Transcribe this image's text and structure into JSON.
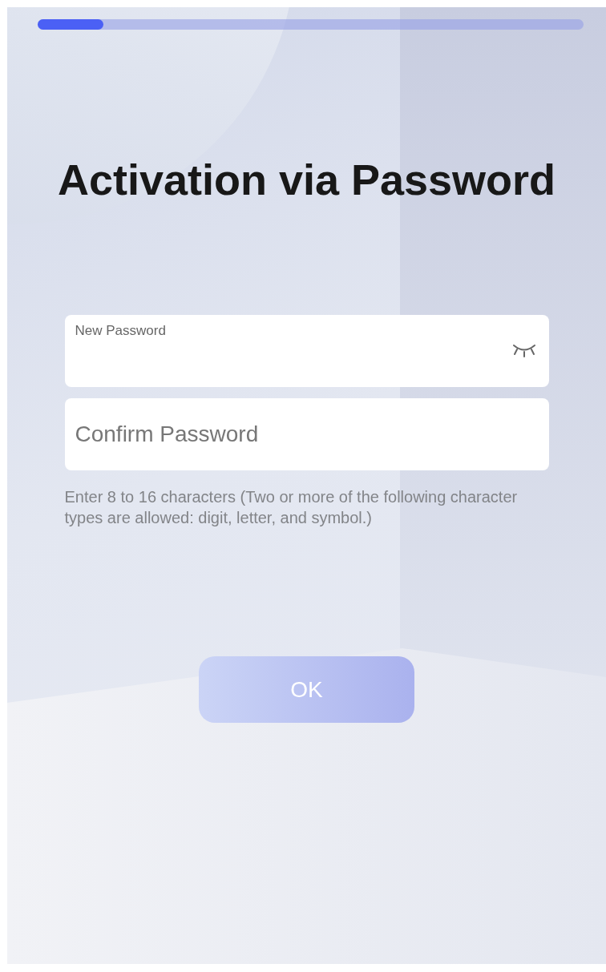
{
  "progress": {
    "level": 0.12
  },
  "title": "Activation via Password",
  "fields": [
    {
      "kind": "floating",
      "label": "New Password",
      "password_visible": false
    },
    {
      "kind": "plain",
      "placeholder": "Confirm Password"
    }
  ],
  "hint": "Enter 8 to 16 characters (Two or more of the following character types are allowed: digit, letter, and symbol.)",
  "button": {
    "label": "OK",
    "disabled": true
  }
}
